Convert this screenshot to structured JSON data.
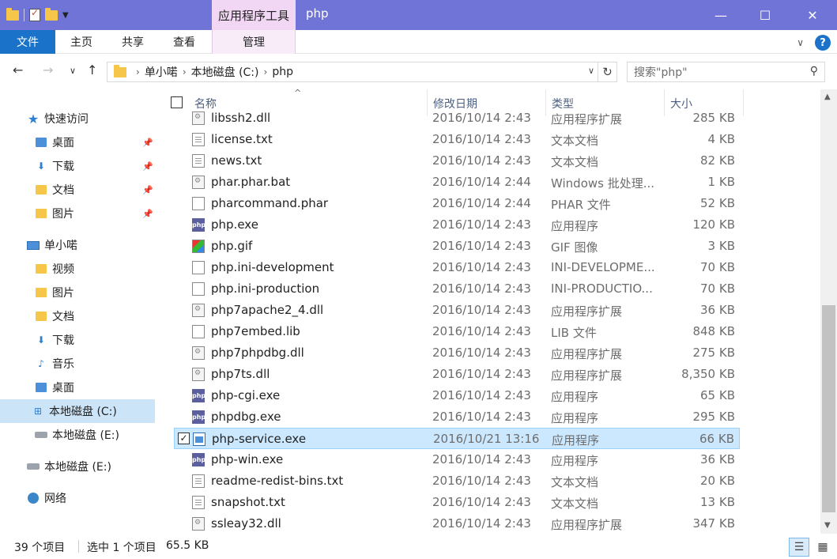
{
  "titlebar": {
    "context_tab": "应用程序工具",
    "title": "php",
    "minimize": "—",
    "maximize": "☐",
    "close": "✕"
  },
  "ribbon": {
    "tabs": [
      "文件",
      "主页",
      "共享",
      "查看",
      "管理"
    ]
  },
  "address": {
    "crumbs": [
      "单小喏",
      "本地磁盘 (C:)",
      "php"
    ],
    "search_placeholder": "搜索\"php\""
  },
  "sidebar": {
    "quick_access": "快速访问",
    "quick_items": [
      "桌面",
      "下载",
      "文档",
      "图片"
    ],
    "pc": "单小喏",
    "pc_items": [
      "视频",
      "图片",
      "文档",
      "下载",
      "音乐",
      "桌面",
      "本地磁盘 (C:)",
      "本地磁盘 (E:)"
    ],
    "drive_e": "本地磁盘 (E:)",
    "network": "网络"
  },
  "columns": {
    "name": "名称",
    "date": "修改日期",
    "type": "类型",
    "size": "大小"
  },
  "files": [
    {
      "name": "libssh2.dll",
      "date": "2016/10/14 2:43",
      "type": "应用程序扩展",
      "size": "285 KB",
      "icon": "dll-icon"
    },
    {
      "name": "license.txt",
      "date": "2016/10/14 2:43",
      "type": "文本文档",
      "size": "4 KB",
      "icon": "text-file-icon"
    },
    {
      "name": "news.txt",
      "date": "2016/10/14 2:43",
      "type": "文本文档",
      "size": "82 KB",
      "icon": "text-file-icon"
    },
    {
      "name": "phar.phar.bat",
      "date": "2016/10/14 2:44",
      "type": "Windows 批处理...",
      "size": "1 KB",
      "icon": "batch-file-icon"
    },
    {
      "name": "pharcommand.phar",
      "date": "2016/10/14 2:44",
      "type": "PHAR 文件",
      "size": "52 KB",
      "icon": "blank-file-icon"
    },
    {
      "name": "php.exe",
      "date": "2016/10/14 2:43",
      "type": "应用程序",
      "size": "120 KB",
      "icon": "php-exe-icon"
    },
    {
      "name": "php.gif",
      "date": "2016/10/14 2:43",
      "type": "GIF 图像",
      "size": "3 KB",
      "icon": "image-file-icon"
    },
    {
      "name": "php.ini-development",
      "date": "2016/10/14 2:43",
      "type": "INI-DEVELOPME...",
      "size": "70 KB",
      "icon": "blank-file-icon"
    },
    {
      "name": "php.ini-production",
      "date": "2016/10/14 2:43",
      "type": "INI-PRODUCTIO...",
      "size": "70 KB",
      "icon": "blank-file-icon"
    },
    {
      "name": "php7apache2_4.dll",
      "date": "2016/10/14 2:43",
      "type": "应用程序扩展",
      "size": "36 KB",
      "icon": "dll-icon"
    },
    {
      "name": "php7embed.lib",
      "date": "2016/10/14 2:43",
      "type": "LIB 文件",
      "size": "848 KB",
      "icon": "blank-file-icon"
    },
    {
      "name": "php7phpdbg.dll",
      "date": "2016/10/14 2:43",
      "type": "应用程序扩展",
      "size": "275 KB",
      "icon": "dll-icon"
    },
    {
      "name": "php7ts.dll",
      "date": "2016/10/14 2:43",
      "type": "应用程序扩展",
      "size": "8,350 KB",
      "icon": "dll-icon"
    },
    {
      "name": "php-cgi.exe",
      "date": "2016/10/14 2:43",
      "type": "应用程序",
      "size": "65 KB",
      "icon": "php-exe-icon"
    },
    {
      "name": "phpdbg.exe",
      "date": "2016/10/14 2:43",
      "type": "应用程序",
      "size": "295 KB",
      "icon": "php-exe-icon"
    },
    {
      "name": "php-service.exe",
      "date": "2016/10/21 13:16",
      "type": "应用程序",
      "size": "66 KB",
      "icon": "service-exe-icon",
      "selected": true
    },
    {
      "name": "php-win.exe",
      "date": "2016/10/14 2:43",
      "type": "应用程序",
      "size": "36 KB",
      "icon": "php-exe-icon"
    },
    {
      "name": "readme-redist-bins.txt",
      "date": "2016/10/14 2:43",
      "type": "文本文档",
      "size": "20 KB",
      "icon": "text-file-icon"
    },
    {
      "name": "snapshot.txt",
      "date": "2016/10/14 2:43",
      "type": "文本文档",
      "size": "13 KB",
      "icon": "text-file-icon"
    },
    {
      "name": "ssleay32.dll",
      "date": "2016/10/14 2:43",
      "type": "应用程序扩展",
      "size": "347 KB",
      "icon": "dll-icon"
    }
  ],
  "status": {
    "count": "39 个项目",
    "selection": "选中 1 个项目",
    "sel_size": "65.5 KB"
  },
  "colors": {
    "titlebar": "#6f74d6",
    "context_tab": "#f1d7f3",
    "file_tab": "#1a73c8",
    "selection": "#cce8ff"
  }
}
